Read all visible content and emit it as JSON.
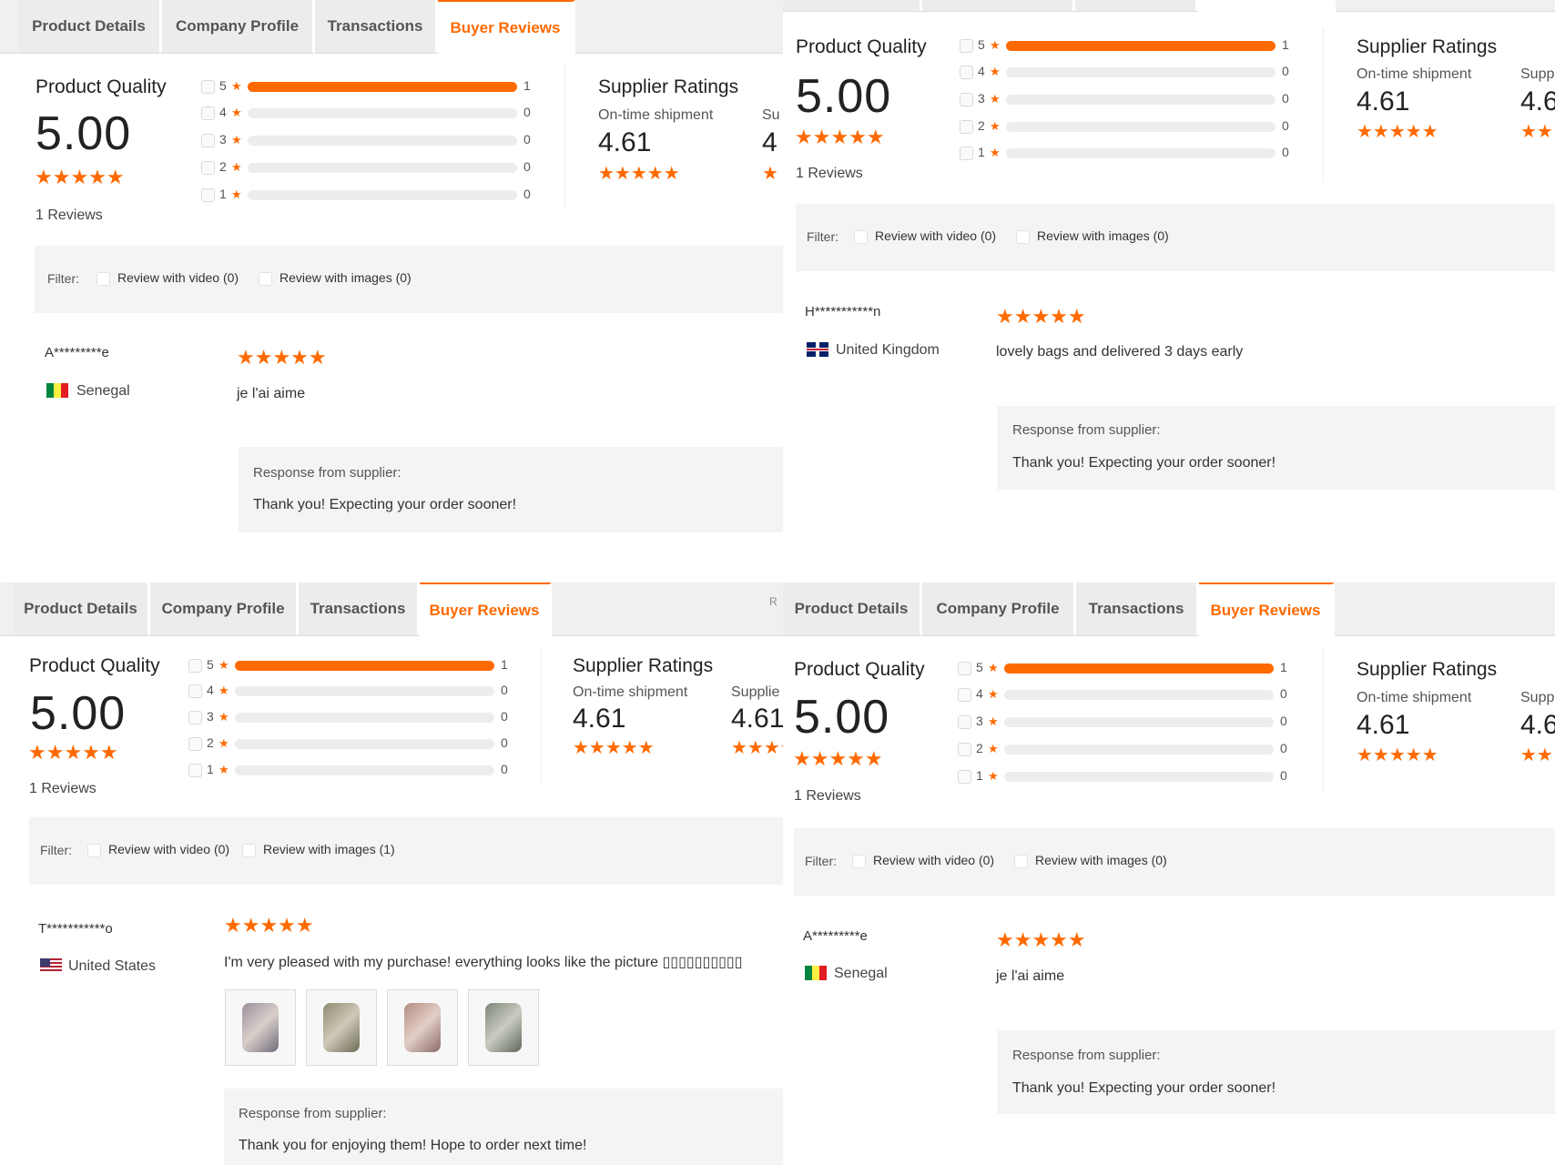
{
  "tabs": [
    {
      "label": "Product Details",
      "active": false
    },
    {
      "label": "Company Profile",
      "active": false
    },
    {
      "label": "Transactions",
      "active": false
    },
    {
      "label": "Buyer Reviews",
      "active": true
    }
  ],
  "summary": {
    "product_quality_label": "Product Quality",
    "score": "5.00",
    "reviews_count": "1 Reviews",
    "rows": [
      {
        "star": "5",
        "count": "1",
        "fill_fraction": 1.0
      },
      {
        "star": "4",
        "count": "0",
        "fill_fraction": 0
      },
      {
        "star": "3",
        "count": "0",
        "fill_fraction": 0
      },
      {
        "star": "2",
        "count": "0",
        "fill_fraction": 0
      },
      {
        "star": "1",
        "count": "0",
        "fill_fraction": 0
      }
    ],
    "supplier_ratings_label": "Supplier Ratings",
    "ontime_label": "On-time shipment",
    "ontime_value": "4.61",
    "second_label_partial_a": "Su",
    "second_label_partial_b": "Supplie",
    "second_label_partial_c": "Supp",
    "second_value_partial_a": "4",
    "second_value_partial_b": "4.61",
    "second_value_partial_c": "4.6"
  },
  "stars_glyph": "★★★★★",
  "star_glyph": "★",
  "filter": {
    "label": "Filter:",
    "video_option": "Review with video (0)",
    "images_option_0": "Review with images (0)",
    "images_option_1": "Review with images (1)"
  },
  "panels": [
    {
      "reviewer": "A*********e",
      "country": "Senegal",
      "review": "je l'ai aime",
      "response_label": "Response from supplier:",
      "response": "Thank you! Expecting your order sooner!"
    },
    {
      "reviewer": "H***********n",
      "country": "United Kingdom",
      "review": "lovely bags and delivered 3 days early",
      "response_label": "Response from supplier:",
      "response": "Thank you! Expecting your order sooner!"
    },
    {
      "reviewer": "T***********o",
      "country": "United States",
      "review": "I'm very pleased with my purchase! everything looks like the picture ▯▯▯▯▯▯▯▯▯▯",
      "response_label": "Response from supplier:",
      "response": "Thank you for enjoying them! Hope to order next time!",
      "photos": [
        "photo-1",
        "photo-2",
        "photo-3",
        "photo-4"
      ],
      "partial_corner_text": "R"
    },
    {
      "reviewer": "A*********e",
      "country": "Senegal",
      "review": "je l'ai aime",
      "response_label": "Response from supplier:",
      "response": "Thank you! Expecting your order sooner!"
    }
  ],
  "colors": {
    "accent": "#ff6a00",
    "bar_bg": "#ededed",
    "filter_bg": "#f4f4f4"
  }
}
